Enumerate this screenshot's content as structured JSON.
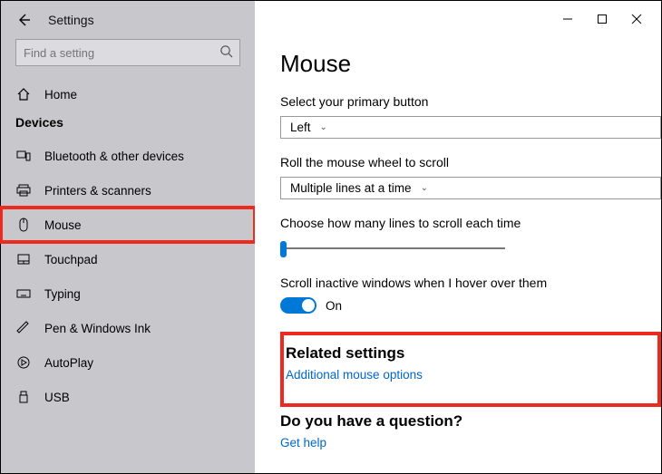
{
  "window": {
    "title": "Settings"
  },
  "search": {
    "placeholder": "Find a setting"
  },
  "category": "Devices",
  "sidebar": {
    "home": "Home",
    "items": [
      {
        "label": "Bluetooth & other devices"
      },
      {
        "label": "Printers & scanners"
      },
      {
        "label": "Mouse"
      },
      {
        "label": "Touchpad"
      },
      {
        "label": "Typing"
      },
      {
        "label": "Pen & Windows Ink"
      },
      {
        "label": "AutoPlay"
      },
      {
        "label": "USB"
      }
    ]
  },
  "main": {
    "title": "Mouse",
    "primary_label": "Select your primary button",
    "primary_value": "Left",
    "wheel_label": "Roll the mouse wheel to scroll",
    "wheel_value": "Multiple lines at a time",
    "lines_label": "Choose how many lines to scroll each time",
    "inactive_label": "Scroll inactive windows when I hover over them",
    "inactive_value": "On",
    "related_heading": "Related settings",
    "related_link": "Additional mouse options",
    "question_heading": "Do you have a question?",
    "question_link": "Get help"
  }
}
